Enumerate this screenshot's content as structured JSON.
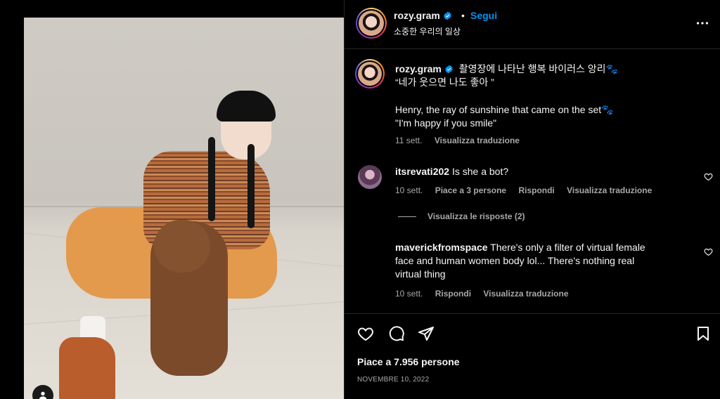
{
  "post": {
    "photo_alt": "photo of a smiling woman in orange outfit crouching next to a brown poodle"
  },
  "header": {
    "username": "rozy.gram",
    "separator": "•",
    "follow_label": "Segui",
    "subtitle": "소중한 우리의 일상",
    "more_icon": "more-horizontal-icon"
  },
  "caption": {
    "username": "rozy.gram",
    "line1": "촬영장에 나타난 행복 바이러스 앙리🐾",
    "line2": "“네가 웃으면 나도 좋아 ”",
    "line3": "Henry, the ray of sunshine that came on the set🐾",
    "line4": "\"I'm happy if you smile\"",
    "time": "11 sett.",
    "translate": "Visualizza traduzione"
  },
  "comments": [
    {
      "username": "itsrevati202",
      "text": "Is she a bot?",
      "time": "10 sett.",
      "likes": "Piace a 3 persone",
      "reply": "Rispondi",
      "translate": "Visualizza traduzione",
      "replies_toggle": "Visualizza le risposte (2)"
    },
    {
      "username": "maverickfromspace",
      "text_line1": "There's only a filter of virtual female",
      "text_line2": "face and human women body lol... There's nothing real",
      "text_line3": "virtual thing",
      "time": "10 sett.",
      "reply": "Rispondi",
      "translate": "Visualizza traduzione"
    }
  ],
  "footer": {
    "likes": "Piace a 7.956 persone",
    "date": "NOVEMBRE 10, 2022"
  },
  "colors": {
    "accent": "#0095f6",
    "muted": "#a8a8a8",
    "background": "#000000"
  }
}
